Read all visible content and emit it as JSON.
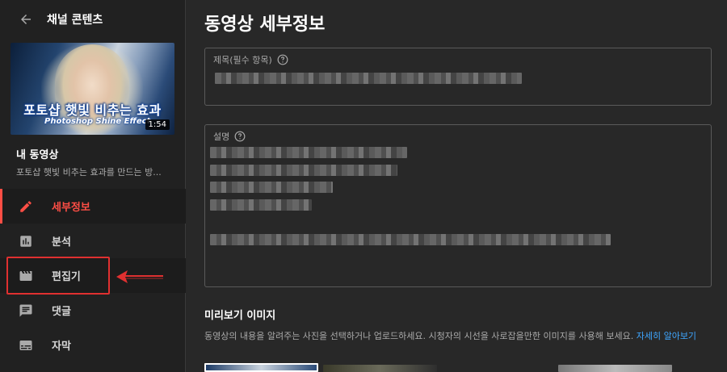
{
  "sidebar": {
    "title": "채널 콘텐츠",
    "thumbnail": {
      "overlay_title": "포토샵 햇빛 비추는 효과",
      "overlay_subtitle": "Photoshop Shine Effect",
      "duration": "1:54"
    },
    "video_title": "내 동영상",
    "video_description": "포토샵 햇빛 비추는 효과를 만드는 방...",
    "nav": [
      {
        "label": "세부정보",
        "icon": "pencil-icon",
        "active": true
      },
      {
        "label": "분석",
        "icon": "analytics-icon",
        "active": false
      },
      {
        "label": "편집기",
        "icon": "clapperboard-icon",
        "active": false
      },
      {
        "label": "댓글",
        "icon": "comment-icon",
        "active": false
      },
      {
        "label": "자막",
        "icon": "subtitles-icon",
        "active": false
      }
    ]
  },
  "main": {
    "page_title": "동영상 세부정보",
    "title_field": {
      "label": "제목(필수 항목)"
    },
    "description_field": {
      "label": "설명"
    },
    "thumbnail_section": {
      "heading": "미리보기 이미지",
      "helper": "동영상의 내용을 알려주는 사진을 선택하거나 업로드하세요. 시청자의 시선을 사로잡을만한 이미지를 사용해 보세요.",
      "learn_more": "자세히 알아보기"
    }
  },
  "colors": {
    "accent_red": "#ff4e45",
    "annotation_red": "#e03030",
    "link_blue": "#3ea6ff",
    "background": "#282828",
    "sidebar_bg": "#212121"
  }
}
